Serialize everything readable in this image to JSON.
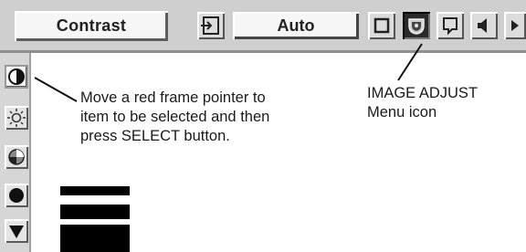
{
  "menu": {
    "title": "Contrast",
    "value": "Auto",
    "toolbar_icons": [
      "input-icon",
      "square-icon",
      "image-adjust-icon",
      "screen-icon",
      "speaker-icon"
    ]
  },
  "adjust": {
    "items": [
      "contrast-icon",
      "brightness-icon",
      "color-icon",
      "black-level-icon",
      "scroll-down-icon"
    ],
    "level_fraction": 0.15
  },
  "callouts": {
    "pointer_line1": "Move a red frame pointer to",
    "pointer_line2": "item to be selected and then",
    "pointer_line3": "press SELECT button.",
    "menu_icon_line1": "IMAGE ADJUST",
    "menu_icon_line2": "Menu icon"
  },
  "colors": {
    "menubar": "#cfcfcf",
    "active_icon_bg": "#2a2a2a",
    "text": "#1a1a1a"
  }
}
